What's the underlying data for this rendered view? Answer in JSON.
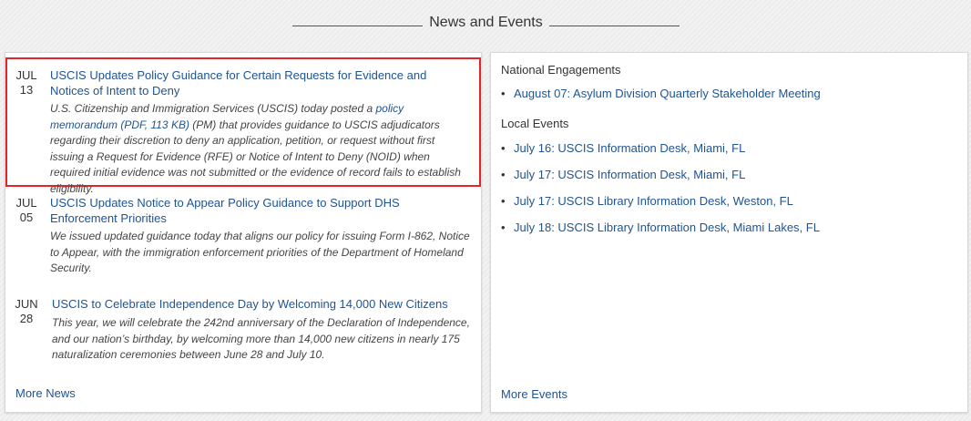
{
  "section": {
    "title": "News and Events"
  },
  "news": {
    "items": [
      {
        "month": "JUL",
        "day": "13",
        "title": "USCIS Updates Policy Guidance for Certain Requests for Evidence and Notices of Intent to Deny",
        "desc_before": "U.S. Citizenship and Immigration Services (USCIS) today posted a ",
        "desc_link": "policy memorandum (PDF, 113 KB)",
        "desc_after": " (PM) that provides guidance to USCIS adjudicators regarding their discretion to deny an application, petition, or request without first issuing a Request for Evidence (RFE) or Notice of Intent to Deny (NOID) when required initial evidence was not submitted or the evidence of record fails to establish eligibility."
      },
      {
        "month": "JUL",
        "day": "05",
        "title": "USCIS Updates Notice to Appear Policy Guidance to Support DHS Enforcement Priorities",
        "desc": "We issued updated guidance today that aligns our policy for issuing Form I-862, Notice to Appear, with the immigration enforcement priorities of the Department of Homeland Security."
      },
      {
        "month": "JUN",
        "day": "28",
        "title": "USCIS to Celebrate Independence Day by Welcoming 14,000 New Citizens",
        "desc": "This year, we will celebrate the 242nd anniversary of the Declaration of Independence, and our nation’s birthday, by welcoming more than 14,000 new citizens in nearly 175 naturalization ceremonies between June 28 and July 10."
      }
    ],
    "more_label": "More News"
  },
  "events": {
    "national_heading": "National Engagements",
    "national": [
      "August 07: Asylum Division Quarterly Stakeholder Meeting"
    ],
    "local_heading": "Local Events",
    "local": [
      "July 16: USCIS Information Desk, Miami, FL",
      "July 17: USCIS Information Desk, Miami, FL",
      "July 17: USCIS Library Information Desk, Weston, FL",
      "July 18: USCIS Library Information Desk, Miami Lakes, FL"
    ],
    "more_label": "More Events"
  },
  "colors": {
    "link": "#205493",
    "highlight": "#e0262b"
  }
}
